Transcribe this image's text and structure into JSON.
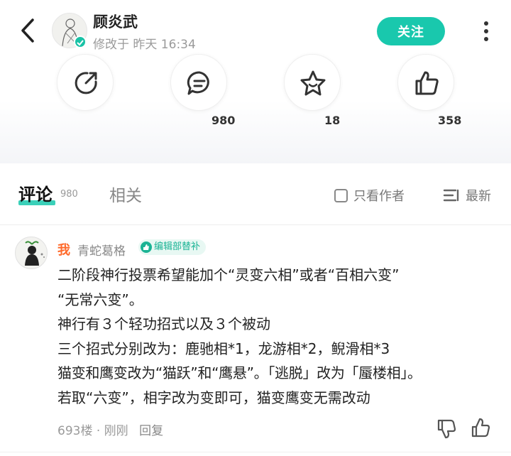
{
  "header": {
    "author_name": "顾炎武",
    "edit_time": "修改于 昨天 16:34",
    "follow_label": "关注"
  },
  "actions": {
    "share_icon": "share-icon",
    "comment_count": "980",
    "favorite_count": "18",
    "like_count": "358"
  },
  "tabs": {
    "comments_label": "评论",
    "comments_count": "980",
    "related_label": "相关",
    "only_author_label": "只看作者",
    "sort_label": "最新"
  },
  "comment": {
    "me_label": "我",
    "user_name": "青蛇葛格",
    "badge_label": "编辑部替补",
    "lines": [
      "二阶段神行投票希望能加个“灵变六相”或者“百相六变”",
      "“无常六变”。",
      "神行有３个轻功招式以及３个被动",
      "三个招式分别改为：鹿驰相*1，龙游相*2，鲵滑相*3",
      "猫变和鹰变改为“猫跃”和“鹰悬”。「逃脱」改为「蜃楼相」。",
      "若取“六变”，相字改为变即可，猫变鹰变无需改动"
    ],
    "floor": "693楼",
    "time": "刚刚",
    "reply_label": "回复"
  },
  "colors": {
    "accent": "#19c8ad",
    "me": "#ff6b2c"
  }
}
